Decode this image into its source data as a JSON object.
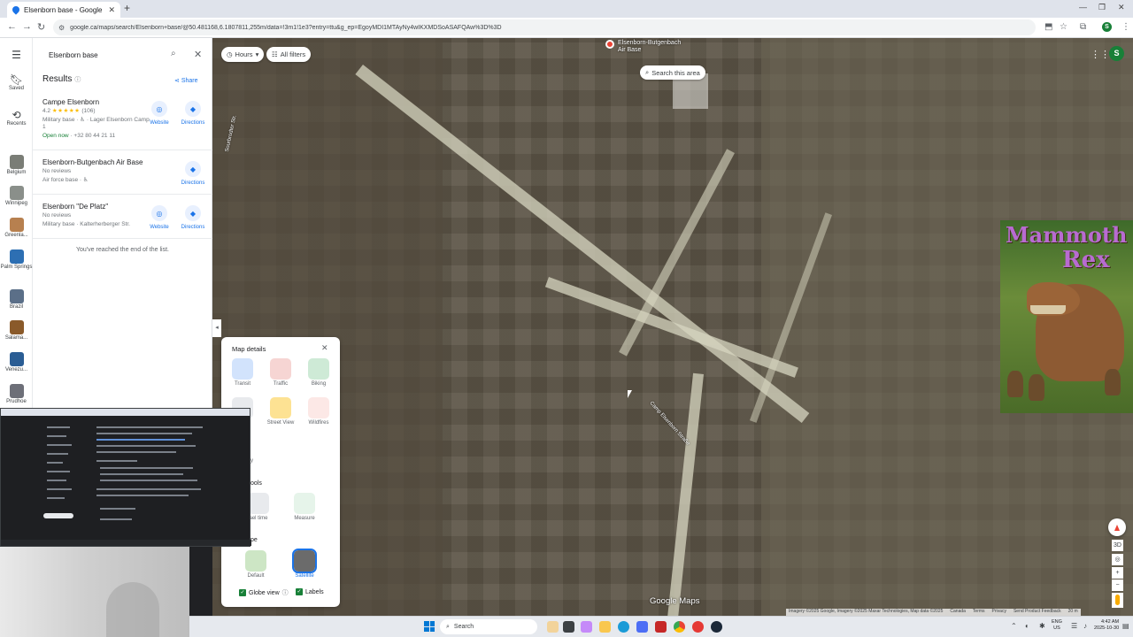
{
  "browser": {
    "tab_title": "Elsenborn base - Google Maps",
    "url": "google.ca/maps/search/Elsenborn+base/@50.481168,6.1807811,255m/data=!3m1!1e3?entry=ttu&g_ep=EgoyMDI1MTAyNy4wIKXMDSoASAFQAw%3D%3D",
    "profile_initial": "S"
  },
  "rail": {
    "items": [
      {
        "label": "Saved",
        "icon": "bookmark-icon"
      },
      {
        "label": "Recents",
        "icon": "history-icon"
      },
      {
        "label": "Belgium",
        "color": "#7a7d76"
      },
      {
        "label": "Winnipeg",
        "color": "#8a8f8a"
      },
      {
        "label": "Greenla...",
        "color": "#b7804f"
      },
      {
        "label": "Palm Springs",
        "color": "#2d6fb3"
      },
      {
        "label": "Brazil",
        "color": "#5b6f88"
      },
      {
        "label": "Salama...",
        "color": "#8a5a2a"
      },
      {
        "label": "Venezu...",
        "color": "#2a5d94"
      },
      {
        "label": "Prudhoe",
        "color": "#6d6f78"
      }
    ]
  },
  "search": {
    "value": "Elsenborn base"
  },
  "results": {
    "heading": "Results",
    "share_label": "Share",
    "items": [
      {
        "name": "Campe Elsenborn",
        "rating": "4.2",
        "stars": "★★★★★",
        "reviews": "(106)",
        "line1": "Military base · ♿ · Lager Elsenborn",
        "line2": "Camp 1",
        "open": "Open now",
        "phone": " · +32 80 44 21 11",
        "website": "Website",
        "directions": "Directions"
      },
      {
        "name": "Elsenborn-Butgenbach Air Base",
        "line1": "No reviews",
        "line2": "Air force base · ♿",
        "directions": "Directions"
      },
      {
        "name": "Elsenborn \"De Platz\"",
        "line1": "No reviews",
        "line2": "Military base · Kalterherberger Str.",
        "website": "Website",
        "directions": "Directions"
      }
    ],
    "end_text": "You've reached the end of the list."
  },
  "map": {
    "chips": {
      "hours": "Hours",
      "filters": "All filters"
    },
    "search_area": "Search this area",
    "pin_label": "Elsenborn-Butgenbach Air Base",
    "street1": "Sourbrodter Str.",
    "street2": "Camp Elsenborn Straße",
    "profile_initial": "S",
    "overlay_text1": "Mammoth",
    "overlay_text2": "Rex",
    "logo": "Google Maps",
    "attribution": [
      "Imagery ©2025 Google, Imagery ©2025 Maxar Technologies, Map data ©2025",
      "Canada",
      "Terms",
      "Privacy",
      "Send Product Feedback",
      "20 m"
    ],
    "ctl_3d": "3D",
    "ctl_zoom_in": "+",
    "ctl_zoom_out": "−"
  },
  "details": {
    "title": "Map details",
    "row1": [
      {
        "label": "Transit",
        "color": "#d2e3fc"
      },
      {
        "label": "Traffic",
        "color": "#f6d5d3"
      },
      {
        "label": "Biking",
        "color": "#ceead6"
      }
    ],
    "row2": [
      {
        "label": "Street View",
        "color": "#fde293"
      },
      {
        "label": "Wildfires",
        "color": "#fce8e6"
      }
    ],
    "row2_partial_label": "y",
    "tools_heading": "ools",
    "tools": [
      {
        "label": "ael time",
        "color": "#e8eaed"
      },
      {
        "label": "Measure",
        "color": "#e6f4ea"
      }
    ],
    "type_heading": "pe",
    "types": [
      {
        "label": "Default",
        "color": "#cde6c5"
      },
      {
        "label": "Satellite",
        "color": "#6b6b6b"
      }
    ],
    "globe_view": "Globe view",
    "labels": "Labels"
  },
  "taskbar": {
    "search_label": "Search",
    "lang_line1": "ENG",
    "lang_line2": "US",
    "time": "4:42 AM",
    "date": "2025-10-30"
  }
}
